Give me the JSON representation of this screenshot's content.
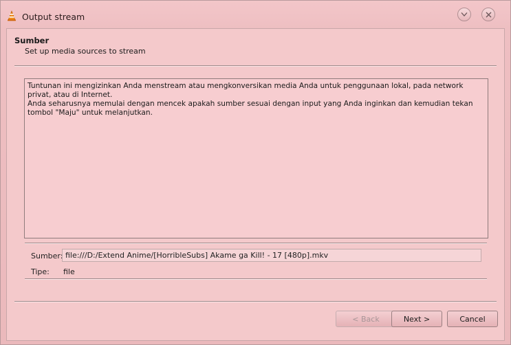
{
  "window": {
    "title": "Output stream"
  },
  "header": {
    "title": "Sumber",
    "subtitle": "Set up media sources to stream"
  },
  "description": {
    "line1": "Tuntunan ini mengizinkan Anda menstream atau mengkonversikan media Anda untuk penggunaan lokal, pada network privat, atau di Internet.",
    "line2": "Anda seharusnya memulai dengan mencek apakah sumber sesuai dengan input yang Anda inginkan dan kemudian tekan tombol \"Maju\" untuk melanjutkan."
  },
  "source": {
    "label": "Sumber:",
    "value": "file:///D:/Extend Anime/[HorribleSubs] Akame ga Kill! - 17 [480p].mkv"
  },
  "type": {
    "label": "Tipe:",
    "value": "file"
  },
  "buttons": {
    "back": "< Back",
    "next": "Next >",
    "cancel": "Cancel"
  },
  "icons": {
    "app": "vlc-cone-icon",
    "minimize": "chevron-down-icon",
    "close": "close-icon"
  },
  "colors": {
    "background": "#f4c9cb",
    "accent": "#e07b1a"
  }
}
